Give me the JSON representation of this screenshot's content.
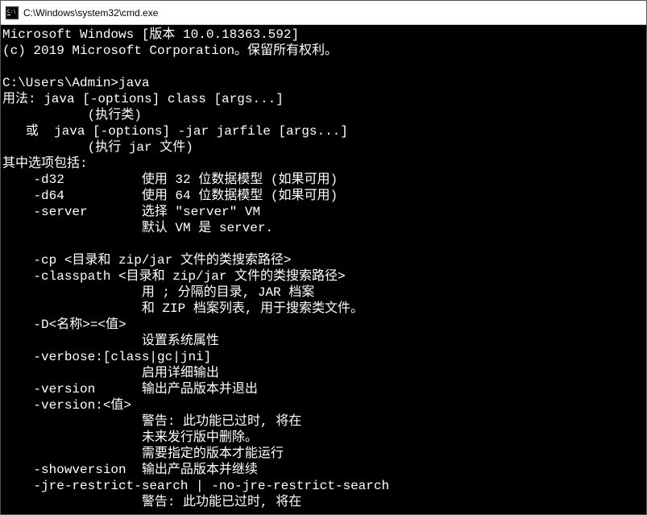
{
  "titlebar": {
    "path": "C:\\Windows\\system32\\cmd.exe"
  },
  "terminal": {
    "lines": [
      "Microsoft Windows [版本 10.0.18363.592]",
      "(c) 2019 Microsoft Corporation。保留所有权利。",
      "",
      "C:\\Users\\Admin>java",
      "用法: java [-options] class [args...]",
      "           (执行类)",
      "   或  java [-options] -jar jarfile [args...]",
      "           (执行 jar 文件)",
      "其中选项包括:",
      "    -d32          使用 32 位数据模型 (如果可用)",
      "    -d64          使用 64 位数据模型 (如果可用)",
      "    -server       选择 \"server\" VM",
      "                  默认 VM 是 server.",
      "",
      "    -cp <目录和 zip/jar 文件的类搜索路径>",
      "    -classpath <目录和 zip/jar 文件的类搜索路径>",
      "                  用 ; 分隔的目录, JAR 档案",
      "                  和 ZIP 档案列表, 用于搜索类文件。",
      "    -D<名称>=<值>",
      "                  设置系统属性",
      "    -verbose:[class|gc|jni]",
      "                  启用详细输出",
      "    -version      输出产品版本并退出",
      "    -version:<值>",
      "                  警告: 此功能已过时, 将在",
      "                  未来发行版中删除。",
      "                  需要指定的版本才能运行",
      "    -showversion  输出产品版本并继续",
      "    -jre-restrict-search | -no-jre-restrict-search",
      "                  警告: 此功能已过时, 将在"
    ]
  }
}
